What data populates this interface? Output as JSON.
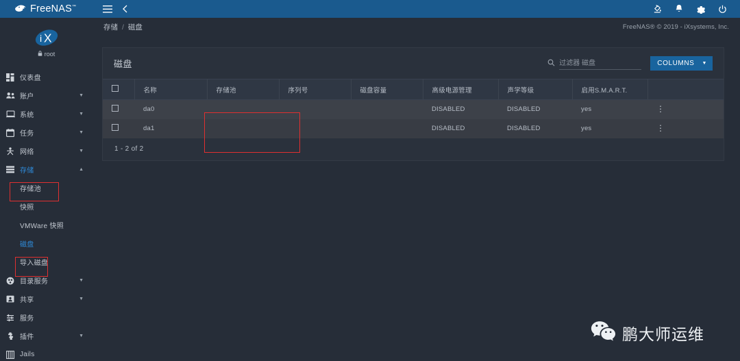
{
  "app": {
    "brand": "FreeNAS",
    "brand_tm": "™"
  },
  "topbar": {
    "menu_icon": "hamburger-icon",
    "collapse_icon": "chevron-left-icon",
    "right_icons": [
      {
        "name": "theme-paint-icon",
        "label": ""
      },
      {
        "name": "notifications-bell-icon",
        "label": ""
      },
      {
        "name": "settings-gear-icon",
        "label": ""
      },
      {
        "name": "power-icon",
        "label": ""
      }
    ]
  },
  "sidebar": {
    "user": {
      "name": "root",
      "lock_icon": "lock-icon",
      "logo": "ix-systems-logo"
    },
    "items": [
      {
        "label": "仪表盘",
        "icon": "dashboard-icon",
        "expandable": false,
        "active": false
      },
      {
        "label": "账户",
        "icon": "accounts-icon",
        "expandable": true,
        "active": false
      },
      {
        "label": "系统",
        "icon": "system-icon",
        "expandable": true,
        "active": false
      },
      {
        "label": "任务",
        "icon": "tasks-icon",
        "expandable": true,
        "active": false
      },
      {
        "label": "网络",
        "icon": "network-icon",
        "expandable": true,
        "active": false
      },
      {
        "label": "存储",
        "icon": "storage-icon",
        "expandable": true,
        "active": true
      }
    ],
    "sub_items": [
      {
        "label": "存储池",
        "active": false
      },
      {
        "label": "快照",
        "active": false
      },
      {
        "label": "VMWare 快照",
        "active": false
      },
      {
        "label": "磁盘",
        "active": true
      },
      {
        "label": "导入磁盘",
        "active": false
      }
    ],
    "items_after": [
      {
        "label": "目录服务",
        "icon": "directory-services-icon",
        "expandable": true,
        "active": false
      },
      {
        "label": "共享",
        "icon": "sharing-icon",
        "expandable": true,
        "active": false
      },
      {
        "label": "服务",
        "icon": "services-icon",
        "expandable": false,
        "active": false
      },
      {
        "label": "插件",
        "icon": "plugins-icon",
        "expandable": true,
        "active": false
      },
      {
        "label": "Jails",
        "icon": "jails-icon",
        "expandable": false,
        "active": false
      }
    ]
  },
  "breadcrumb": {
    "parent": "存储",
    "separator": "/",
    "current": "磁盘"
  },
  "footer_note": "FreeNAS® © 2019 - iXsystems, Inc.",
  "card": {
    "title": "磁盘",
    "search": {
      "placeholder": "过滤器 磁盘",
      "value": "",
      "icon": "search-icon"
    },
    "columns_button": {
      "label": "COLUMNS",
      "caret": "▼"
    },
    "headers": [
      "名称",
      "存储池",
      "序列号",
      "磁盘容量",
      "高级电源管理",
      "声学等级",
      "启用S.M.A.R.T."
    ],
    "rows": [
      {
        "name": "da0",
        "pool": "",
        "serial": "",
        "size": "",
        "apm": "DISABLED",
        "acoustic": "DISABLED",
        "smart": "yes",
        "menu_icon": "kebab-menu-icon"
      },
      {
        "name": "da1",
        "pool": "",
        "serial": "",
        "size": "",
        "apm": "DISABLED",
        "acoustic": "DISABLED",
        "smart": "yes",
        "menu_icon": "kebab-menu-icon"
      }
    ],
    "pagination": "1 - 2 of 2"
  },
  "watermark": {
    "text": "鹏大师运维",
    "icon": "wechat-icon"
  },
  "colors": {
    "topbar": "#1a5a8e",
    "sidebar": "#262d38",
    "card": "#2a313c",
    "accent": "#2e8ad8",
    "button": "#19649e",
    "annotation": "#e03030",
    "row_odd": "#3d4149",
    "row_even": "#383c44"
  }
}
